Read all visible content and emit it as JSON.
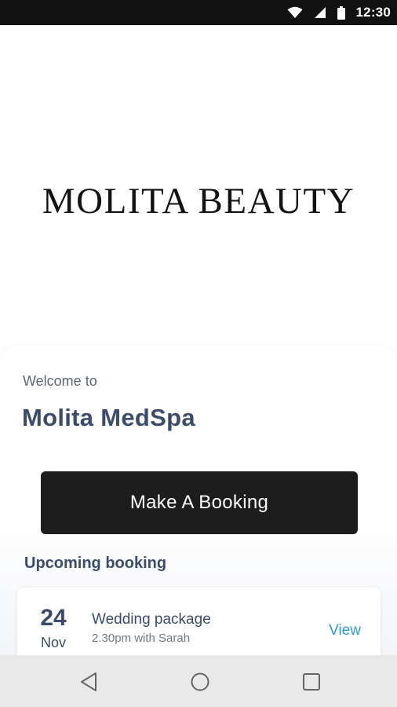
{
  "status_bar": {
    "time": "12:30",
    "icons": [
      "wifi-icon",
      "cellular-signal-icon",
      "battery-icon"
    ]
  },
  "hero": {
    "logo_text": "MOLITA BEAUTY"
  },
  "welcome": {
    "greeting": "Welcome to",
    "venue_name": "Molita MedSpa"
  },
  "actions": {
    "booking_button_label": "Make A Booking"
  },
  "upcoming": {
    "section_title": "Upcoming booking",
    "booking": {
      "day": "24",
      "month": "Nov",
      "service": "Wedding package",
      "details": "2.30pm with Sarah",
      "view_label": "View"
    }
  },
  "nav_bar": {
    "icons": [
      "back-icon",
      "home-icon",
      "recent-apps-icon"
    ]
  },
  "colors": {
    "status_bar": "#111111",
    "heading": "#3b4c6b",
    "button_bg": "#1d1d1d",
    "link": "#2a9bd6",
    "nav_bar": "#e9e9ea"
  }
}
